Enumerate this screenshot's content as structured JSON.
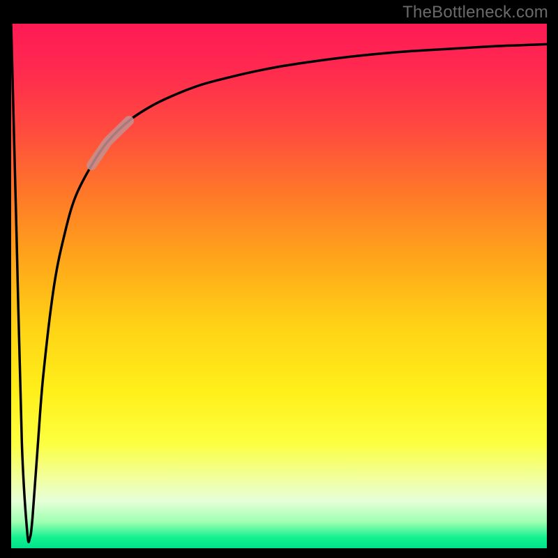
{
  "watermark": "TheBottleneck.com",
  "chart_data": {
    "type": "line",
    "title": "",
    "xlabel": "",
    "ylabel": "",
    "x_range": [
      0,
      100
    ],
    "y_range": [
      0,
      100
    ],
    "series": [
      {
        "name": "curve",
        "x_values": [
          0,
          1,
          2,
          3,
          3.5,
          4,
          5,
          6,
          8,
          10,
          12,
          15,
          18,
          22,
          26,
          30,
          35,
          40,
          45,
          50,
          55,
          60,
          65,
          70,
          75,
          80,
          85,
          90,
          95,
          100
        ],
        "y_values": [
          100,
          60,
          20,
          3,
          2,
          6,
          20,
          33,
          50,
          60,
          67,
          73,
          77.5,
          81.5,
          84.2,
          86.2,
          88.2,
          89.6,
          90.8,
          91.8,
          92.6,
          93.3,
          93.9,
          94.4,
          94.8,
          95.1,
          95.4,
          95.7,
          95.9,
          96.1
        ]
      }
    ],
    "annotations": [
      {
        "name": "highlight-band",
        "x_start": 15,
        "x_end": 22
      }
    ],
    "gradient_stops": [
      {
        "offset": 0.0,
        "color": "#ff1a54"
      },
      {
        "offset": 0.33,
        "color": "#ff7a28"
      },
      {
        "offset": 0.7,
        "color": "#ffef1a"
      },
      {
        "offset": 0.91,
        "color": "#e6ffd8"
      },
      {
        "offset": 1.0,
        "color": "#00e28a"
      }
    ]
  }
}
